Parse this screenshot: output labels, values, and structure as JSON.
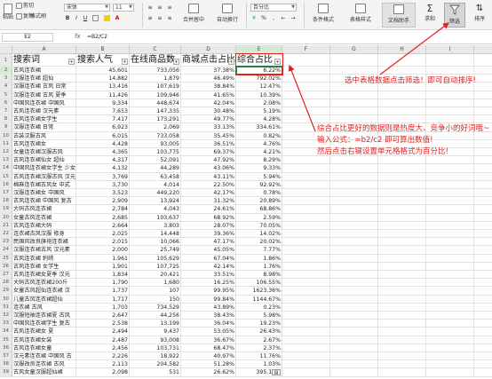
{
  "ribbon": {
    "paste_label": "粘贴",
    "cut_label": "剪切",
    "copy_label": "复制",
    "format_painter_label": "格式刷",
    "font_name": "宋体",
    "font_size": "11",
    "bold": "B",
    "italic": "I",
    "underline": "U",
    "merge_label": "合并居中",
    "wrap_label": "自动换行",
    "number_format": "百分比",
    "cond_format_label": "条件格式",
    "table_style_label": "表格样式",
    "doc_helper_label": "文档助手",
    "sum_label": "求和",
    "filter_label": "筛选",
    "sort_label": "排序"
  },
  "formula_bar": {
    "cell_ref": "E2",
    "fx": "fx",
    "formula": "=B2/C2"
  },
  "columns": [
    "A",
    "B",
    "C",
    "D",
    "E",
    "F",
    "G",
    "H",
    "I",
    "J",
    "K"
  ],
  "headers": [
    "搜索词",
    "搜索人气",
    "在线商品数",
    "商城点击占比",
    "综合占比"
  ],
  "rows": [
    [
      "古风连衣裙",
      "45,601",
      "733,056",
      "37.38%",
      "6.22%"
    ],
    [
      "汉服连衣裙 超仙",
      "14,882",
      "1,879",
      "46.49%",
      "792.02%"
    ],
    [
      "汉服连衣裙 古风 日常",
      "13,416",
      "107,619",
      "38.84%",
      "12.47%"
    ],
    [
      "汉服连衣裙 古风 夏季",
      "11,426",
      "109,946",
      "41.65%",
      "10.39%"
    ],
    [
      "中国风连衣裙 中国风",
      "9,334",
      "448,674",
      "42.04%",
      "2.08%"
    ],
    [
      "古风连衣裙 汉元素",
      "7,653",
      "147,335",
      "30.48%",
      "5.19%"
    ],
    [
      "古风连衣裙女学生",
      "7,417",
      "173,291",
      "49.77%",
      "4.28%"
    ],
    [
      "汉服连衣裙 日常",
      "6,923",
      "2,069",
      "33.13%",
      "334.61%"
    ],
    [
      "古装汉服古风",
      "6,015",
      "733,058",
      "35.45%",
      "0.82%"
    ],
    [
      "古风连衣裙女",
      "4,428",
      "93,005",
      "36.51%",
      "4.76%"
    ],
    [
      "女童连衣裙汉服古风",
      "4,365",
      "103,775",
      "69.37%",
      "4.21%"
    ],
    [
      "古风连衣裙仙女 超仙",
      "4,317",
      "52,091",
      "47.92%",
      "8.29%"
    ],
    [
      "中国风连衣裙女学生 少女",
      "4,132",
      "44,289",
      "43.06%",
      "9.33%"
    ],
    [
      "古风连衣裙汉服古风 汉元",
      "3,769",
      "63,458",
      "43.11%",
      "5.94%"
    ],
    [
      "棉麻连衣裙古风女 中式",
      "3,730",
      "4,014",
      "22.50%",
      "92.92%"
    ],
    [
      "汉服连衣裙女 中国风",
      "3,523",
      "449,220",
      "42.17%",
      "0.78%"
    ],
    [
      "古风连衣裙 中国风 复古",
      "2,909",
      "13,924",
      "31.32%",
      "20.89%"
    ],
    [
      "大码古风连衣裙",
      "2,784",
      "4,043",
      "24.61%",
      "68.86%"
    ],
    [
      "女童古风连衣裙",
      "2,685",
      "103,637",
      "68.92%",
      "2.59%"
    ],
    [
      "古风连衣裙大码",
      "2,664",
      "3,803",
      "28.07%",
      "70.05%"
    ],
    [
      "连衣裙古风汉服 修身",
      "2,025",
      "14,448",
      "39.36%",
      "14.02%"
    ],
    [
      "民国风改良旗袍连衣裙",
      "2,015",
      "10,066",
      "47.17%",
      "20.02%"
    ],
    [
      "汉服连衣裙古风 汉元素",
      "2,000",
      "25,749",
      "45.05%",
      "7.77%"
    ],
    [
      "古风连衣裙 刺绣",
      "1,961",
      "105,629",
      "67.04%",
      "1.86%"
    ],
    [
      "古风连衣裙 女学生",
      "1,901",
      "107,725",
      "42.14%",
      "1.76%"
    ],
    [
      "古风连衣裙女夏季 汉元",
      "1,834",
      "20,421",
      "33.51%",
      "8.98%"
    ],
    [
      "大码古风连衣裙200斤",
      "1,790",
      "1,680",
      "16.25%",
      "106.55%"
    ],
    [
      "女童古风超仙连衣裙 汉",
      "1,737",
      "107",
      "99.95%",
      "1623.36%"
    ],
    [
      "儿童古风连衣裙超仙",
      "1,717",
      "150",
      "99.84%",
      "1144.67%"
    ],
    [
      "连衣裙 古风",
      "1,703",
      "734,529",
      "43.89%",
      "0.23%"
    ],
    [
      "汉服短袖连衣裙夏 古风",
      "2,647",
      "44,256",
      "38.43%",
      "5.98%"
    ],
    [
      "中国风连衣裙学生 复古",
      "2,538",
      "13,199",
      "36.04%",
      "19.23%"
    ],
    [
      "古风连衣裙女 夏",
      "2,494",
      "9,437",
      "53.05%",
      "26.43%"
    ],
    [
      "古风连衣裙女装",
      "2,487",
      "93,008",
      "36.67%",
      "2.67%"
    ],
    [
      "古风连衣裙女童",
      "2,456",
      "103,731",
      "68.47%",
      "2.37%"
    ],
    [
      "汉元素连衣裙 中国风 古",
      "2,226",
      "18,922",
      "40.97%",
      "11.76%"
    ],
    [
      "汉服改良连衣裙 古风",
      "2,113",
      "204,582",
      "51.28%",
      "1.03%"
    ],
    [
      "古风女童汉服超仙裙",
      "2,098",
      "531",
      "26.62%",
      "395.10%"
    ]
  ],
  "annotations": {
    "note1": "选中表格数据点击筛选！即可自动排序!",
    "note2": "综合占比更好的数据则是热度大、竞争小的好词哦~\n输入公式：=b2/c2 即可算出数值!\n然后点击右键设置单元格格式为百分比!"
  },
  "colors": {
    "accent_green": "#2f7d3e",
    "annotation_red": "#e02020",
    "header_bg": "#e9e9e9"
  }
}
